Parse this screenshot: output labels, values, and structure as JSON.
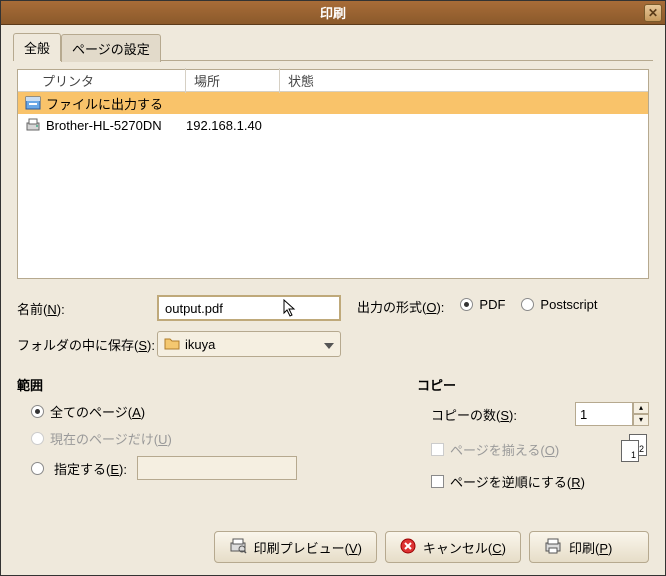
{
  "title": "印刷",
  "tabs": {
    "general": "全般",
    "page_setup": "ページの設定"
  },
  "printer_headers": {
    "name": "プリンタ",
    "location": "場所",
    "status": "状態"
  },
  "printers": [
    {
      "name": "ファイルに出力する",
      "location": "",
      "selected": true
    },
    {
      "name": "Brother-HL-5270DN",
      "location": "192.168.1.40",
      "selected": false
    }
  ],
  "labels": {
    "name": "名前(N):",
    "save_in_folder": "フォルダの中に保存(S):",
    "output_format": "出力の形式(O):",
    "pdf": "PDF",
    "postscript": "Postscript",
    "range_title": "範囲",
    "all_pages": "全てのページ(A)",
    "current_page": "現在のページだけ(U)",
    "specify": "指定する(E):",
    "copy_title": "コピー",
    "copies": "コピーの数(S):",
    "collate": "ページを揃える(O)",
    "reverse": "ページを逆順にする(R)",
    "preview": "印刷プレビュー(V)",
    "cancel": "キャンセル(C)",
    "print": "印刷(P)"
  },
  "values": {
    "filename": "output.pdf",
    "folder": "ikuya",
    "output_format": "PDF",
    "copies": "1",
    "range_mode": "all",
    "collate": false,
    "reverse": false,
    "page_thumb_1": "1",
    "page_thumb_2": "2"
  }
}
